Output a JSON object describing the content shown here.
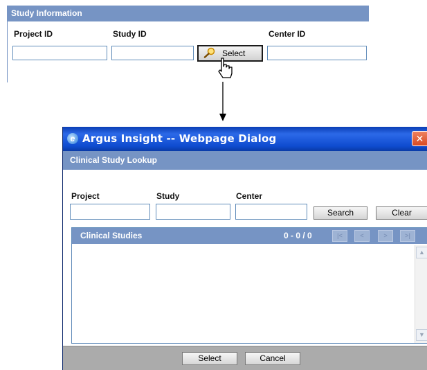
{
  "study_info": {
    "title": "Study Information",
    "project_id_label": "Project ID",
    "study_id_label": "Study ID",
    "center_id_label": "Center ID",
    "project_id_value": "",
    "study_id_value": "",
    "center_id_value": "",
    "select_button": "Select"
  },
  "dialog": {
    "title": "Argus Insight -- Webpage Dialog",
    "close_glyph": "✕",
    "lookup_title": "Clinical Study Lookup",
    "project_label": "Project",
    "study_label": "Study",
    "center_label": "Center",
    "project_value": "",
    "study_value": "",
    "center_value": "",
    "search_button": "Search",
    "clear_button": "Clear",
    "grid_title": "Clinical Studies",
    "record_count": "0 - 0 / 0",
    "pager": {
      "first": "|<",
      "prev": "<",
      "next": ">",
      "last": ">|"
    },
    "select_button": "Select",
    "cancel_button": "Cancel"
  },
  "icons": [
    "magnifier-icon",
    "hand-cursor-icon",
    "arrow-down-icon",
    "ie-icon",
    "close-icon",
    "scroll-up-icon",
    "scroll-down-icon"
  ]
}
